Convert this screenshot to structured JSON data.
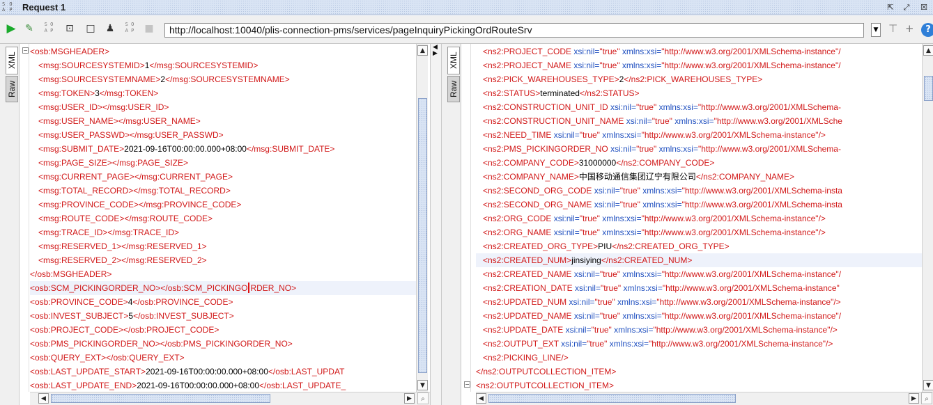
{
  "window": {
    "title": "Request 1",
    "logo_text": "SO\nAP"
  },
  "toolbar": {
    "url": "http://localhost:10040/plis-connection-pms/services/pageInquiryPickingOrdRouteSrv"
  },
  "tabs": {
    "xml": "XML",
    "raw": "Raw"
  },
  "request_lines": [
    {
      "indent": 0,
      "segs": [
        [
          "t",
          "<osb:MSGHEADER>"
        ]
      ]
    },
    {
      "indent": 1,
      "segs": [
        [
          "t",
          "<msg:SOURCESYSTEMID>"
        ],
        [
          "x",
          "1"
        ],
        [
          "t",
          "</msg:SOURCESYSTEMID>"
        ]
      ]
    },
    {
      "indent": 1,
      "segs": [
        [
          "t",
          "<msg:SOURCESYSTEMNAME>"
        ],
        [
          "x",
          "2"
        ],
        [
          "t",
          "</msg:SOURCESYSTEMNAME>"
        ]
      ]
    },
    {
      "indent": 1,
      "segs": [
        [
          "t",
          "<msg:TOKEN>"
        ],
        [
          "x",
          "3"
        ],
        [
          "t",
          "</msg:TOKEN>"
        ]
      ]
    },
    {
      "indent": 1,
      "segs": [
        [
          "t",
          "<msg:USER_ID></msg:USER_ID>"
        ]
      ]
    },
    {
      "indent": 1,
      "segs": [
        [
          "t",
          "<msg:USER_NAME></msg:USER_NAME>"
        ]
      ]
    },
    {
      "indent": 1,
      "segs": [
        [
          "t",
          "<msg:USER_PASSWD></msg:USER_PASSWD>"
        ]
      ]
    },
    {
      "indent": 1,
      "segs": [
        [
          "t",
          "<msg:SUBMIT_DATE>"
        ],
        [
          "x",
          "2021-09-16T00:00:00.000+08:00"
        ],
        [
          "t",
          "</msg:SUBMIT_DATE>"
        ]
      ]
    },
    {
      "indent": 1,
      "segs": [
        [
          "t",
          "<msg:PAGE_SIZE></msg:PAGE_SIZE>"
        ]
      ]
    },
    {
      "indent": 1,
      "segs": [
        [
          "t",
          "<msg:CURRENT_PAGE></msg:CURRENT_PAGE>"
        ]
      ]
    },
    {
      "indent": 1,
      "segs": [
        [
          "t",
          "<msg:TOTAL_RECORD></msg:TOTAL_RECORD>"
        ]
      ]
    },
    {
      "indent": 1,
      "segs": [
        [
          "t",
          "<msg:PROVINCE_CODE></msg:PROVINCE_CODE>"
        ]
      ]
    },
    {
      "indent": 1,
      "segs": [
        [
          "t",
          "<msg:ROUTE_CODE></msg:ROUTE_CODE>"
        ]
      ]
    },
    {
      "indent": 1,
      "segs": [
        [
          "t",
          "<msg:TRACE_ID></msg:TRACE_ID>"
        ]
      ]
    },
    {
      "indent": 1,
      "segs": [
        [
          "t",
          "<msg:RESERVED_1></msg:RESERVED_1>"
        ]
      ]
    },
    {
      "indent": 1,
      "segs": [
        [
          "t",
          "<msg:RESERVED_2></msg:RESERVED_2>"
        ]
      ]
    },
    {
      "indent": 0,
      "segs": [
        [
          "t",
          "</osb:MSGHEADER>"
        ]
      ]
    },
    {
      "indent": 0,
      "hl": true,
      "caret_after": "<osb:SCM_PICKINGORDER_NO></osb:SCM_PICKINGO",
      "segs": [
        [
          "t",
          "<osb:SCM_PICKINGORDER_NO></osb:SCM_PICKINGORDER_NO>"
        ]
      ]
    },
    {
      "indent": 0,
      "segs": [
        [
          "t",
          "<osb:PROVINCE_CODE>"
        ],
        [
          "x",
          "4"
        ],
        [
          "t",
          "</osb:PROVINCE_CODE>"
        ]
      ]
    },
    {
      "indent": 0,
      "segs": [
        [
          "t",
          "<osb:INVEST_SUBJECT>"
        ],
        [
          "x",
          "5"
        ],
        [
          "t",
          "</osb:INVEST_SUBJECT>"
        ]
      ]
    },
    {
      "indent": 0,
      "segs": [
        [
          "t",
          "<osb:PROJECT_CODE></osb:PROJECT_CODE>"
        ]
      ]
    },
    {
      "indent": 0,
      "segs": [
        [
          "t",
          "<osb:PMS_PICKINGORDER_NO></osb:PMS_PICKINGORDER_NO>"
        ]
      ]
    },
    {
      "indent": 0,
      "segs": [
        [
          "t",
          "<osb:QUERY_EXT></osb:QUERY_EXT>"
        ]
      ]
    },
    {
      "indent": 0,
      "segs": [
        [
          "t",
          "<osb:LAST_UPDATE_START>"
        ],
        [
          "x",
          "2021-09-16T00:00:00.000+08:00"
        ],
        [
          "t",
          "</osb:LAST_UPDAT"
        ]
      ]
    },
    {
      "indent": 0,
      "segs": [
        [
          "t",
          "<osb:LAST_UPDATE_END>"
        ],
        [
          "x",
          "2021-09-16T00:00:00.000+08:00"
        ],
        [
          "t",
          "</osb:LAST_UPDATE_"
        ]
      ]
    }
  ],
  "response_lines": [
    {
      "indent": 1,
      "segs": [
        [
          "t",
          "<ns2:PROJECT_CODE "
        ],
        [
          "a",
          "xsi:nil="
        ],
        [
          "v",
          "\"true\" "
        ],
        [
          "a",
          "xmlns:xsi="
        ],
        [
          "v",
          "\"http://www.w3.org/2001/XMLSchema-instance\"/"
        ]
      ]
    },
    {
      "indent": 1,
      "segs": [
        [
          "t",
          "<ns2:PROJECT_NAME "
        ],
        [
          "a",
          "xsi:nil="
        ],
        [
          "v",
          "\"true\" "
        ],
        [
          "a",
          "xmlns:xsi="
        ],
        [
          "v",
          "\"http://www.w3.org/2001/XMLSchema-instance\"/"
        ]
      ]
    },
    {
      "indent": 1,
      "segs": [
        [
          "t",
          "<ns2:PICK_WAREHOUSES_TYPE>"
        ],
        [
          "x",
          "2"
        ],
        [
          "t",
          "</ns2:PICK_WAREHOUSES_TYPE>"
        ]
      ]
    },
    {
      "indent": 1,
      "segs": [
        [
          "t",
          "<ns2:STATUS>"
        ],
        [
          "x",
          "terminated"
        ],
        [
          "t",
          "</ns2:STATUS>"
        ]
      ]
    },
    {
      "indent": 1,
      "segs": [
        [
          "t",
          "<ns2:CONSTRUCTION_UNIT_ID "
        ],
        [
          "a",
          "xsi:nil="
        ],
        [
          "v",
          "\"true\" "
        ],
        [
          "a",
          "xmlns:xsi="
        ],
        [
          "v",
          "\"http://www.w3.org/2001/XMLSchema-"
        ]
      ]
    },
    {
      "indent": 1,
      "segs": [
        [
          "t",
          "<ns2:CONSTRUCTION_UNIT_NAME "
        ],
        [
          "a",
          "xsi:nil="
        ],
        [
          "v",
          "\"true\" "
        ],
        [
          "a",
          "xmlns:xsi="
        ],
        [
          "v",
          "\"http://www.w3.org/2001/XMLSche"
        ]
      ]
    },
    {
      "indent": 1,
      "segs": [
        [
          "t",
          "<ns2:NEED_TIME "
        ],
        [
          "a",
          "xsi:nil="
        ],
        [
          "v",
          "\"true\" "
        ],
        [
          "a",
          "xmlns:xsi="
        ],
        [
          "v",
          "\"http://www.w3.org/2001/XMLSchema-instance\"/>"
        ]
      ]
    },
    {
      "indent": 1,
      "segs": [
        [
          "t",
          "<ns2:PMS_PICKINGORDER_NO "
        ],
        [
          "a",
          "xsi:nil="
        ],
        [
          "v",
          "\"true\" "
        ],
        [
          "a",
          "xmlns:xsi="
        ],
        [
          "v",
          "\"http://www.w3.org/2001/XMLSchema-"
        ]
      ]
    },
    {
      "indent": 1,
      "segs": [
        [
          "t",
          "<ns2:COMPANY_CODE>"
        ],
        [
          "x",
          "31000000"
        ],
        [
          "t",
          "</ns2:COMPANY_CODE>"
        ]
      ]
    },
    {
      "indent": 1,
      "segs": [
        [
          "t",
          "<ns2:COMPANY_NAME>"
        ],
        [
          "x",
          "中国移动通信集团辽宁有限公司"
        ],
        [
          "t",
          "</ns2:COMPANY_NAME>"
        ]
      ]
    },
    {
      "indent": 1,
      "segs": [
        [
          "t",
          "<ns2:SECOND_ORG_CODE "
        ],
        [
          "a",
          "xsi:nil="
        ],
        [
          "v",
          "\"true\" "
        ],
        [
          "a",
          "xmlns:xsi="
        ],
        [
          "v",
          "\"http://www.w3.org/2001/XMLSchema-insta"
        ]
      ]
    },
    {
      "indent": 1,
      "segs": [
        [
          "t",
          "<ns2:SECOND_ORG_NAME "
        ],
        [
          "a",
          "xsi:nil="
        ],
        [
          "v",
          "\"true\" "
        ],
        [
          "a",
          "xmlns:xsi="
        ],
        [
          "v",
          "\"http://www.w3.org/2001/XMLSchema-insta"
        ]
      ]
    },
    {
      "indent": 1,
      "segs": [
        [
          "t",
          "<ns2:ORG_CODE "
        ],
        [
          "a",
          "xsi:nil="
        ],
        [
          "v",
          "\"true\" "
        ],
        [
          "a",
          "xmlns:xsi="
        ],
        [
          "v",
          "\"http://www.w3.org/2001/XMLSchema-instance\"/>"
        ]
      ]
    },
    {
      "indent": 1,
      "segs": [
        [
          "t",
          "<ns2:ORG_NAME "
        ],
        [
          "a",
          "xsi:nil="
        ],
        [
          "v",
          "\"true\" "
        ],
        [
          "a",
          "xmlns:xsi="
        ],
        [
          "v",
          "\"http://www.w3.org/2001/XMLSchema-instance\"/>"
        ]
      ]
    },
    {
      "indent": 1,
      "segs": [
        [
          "t",
          "<ns2:CREATED_ORG_TYPE>"
        ],
        [
          "x",
          "PIU"
        ],
        [
          "t",
          "</ns2:CREATED_ORG_TYPE>"
        ]
      ]
    },
    {
      "indent": 1,
      "hl": true,
      "segs": [
        [
          "t",
          "<ns2:CREATED_NUM>"
        ],
        [
          "x",
          "jinsiying"
        ],
        [
          "t",
          "</ns2:CREATED_NUM>"
        ]
      ]
    },
    {
      "indent": 1,
      "segs": [
        [
          "t",
          "<ns2:CREATED_NAME "
        ],
        [
          "a",
          "xsi:nil="
        ],
        [
          "v",
          "\"true\" "
        ],
        [
          "a",
          "xmlns:xsi="
        ],
        [
          "v",
          "\"http://www.w3.org/2001/XMLSchema-instance\"/"
        ]
      ]
    },
    {
      "indent": 1,
      "segs": [
        [
          "t",
          "<ns2:CREATION_DATE "
        ],
        [
          "a",
          "xsi:nil="
        ],
        [
          "v",
          "\"true\" "
        ],
        [
          "a",
          "xmlns:xsi="
        ],
        [
          "v",
          "\"http://www.w3.org/2001/XMLSchema-instance\""
        ]
      ]
    },
    {
      "indent": 1,
      "segs": [
        [
          "t",
          "<ns2:UPDATED_NUM "
        ],
        [
          "a",
          "xsi:nil="
        ],
        [
          "v",
          "\"true\" "
        ],
        [
          "a",
          "xmlns:xsi="
        ],
        [
          "v",
          "\"http://www.w3.org/2001/XMLSchema-instance\"/>"
        ]
      ]
    },
    {
      "indent": 1,
      "segs": [
        [
          "t",
          "<ns2:UPDATED_NAME "
        ],
        [
          "a",
          "xsi:nil="
        ],
        [
          "v",
          "\"true\" "
        ],
        [
          "a",
          "xmlns:xsi="
        ],
        [
          "v",
          "\"http://www.w3.org/2001/XMLSchema-instance\"/"
        ]
      ]
    },
    {
      "indent": 1,
      "segs": [
        [
          "t",
          "<ns2:UPDATE_DATE "
        ],
        [
          "a",
          "xsi:nil="
        ],
        [
          "v",
          "\"true\" "
        ],
        [
          "a",
          "xmlns:xsi="
        ],
        [
          "v",
          "\"http://www.w3.org/2001/XMLSchema-instance\"/>"
        ]
      ]
    },
    {
      "indent": 1,
      "segs": [
        [
          "t",
          "<ns2:OUTPUT_EXT "
        ],
        [
          "a",
          "xsi:nil="
        ],
        [
          "v",
          "\"true\" "
        ],
        [
          "a",
          "xmlns:xsi="
        ],
        [
          "v",
          "\"http://www.w3.org/2001/XMLSchema-instance\"/>"
        ]
      ]
    },
    {
      "indent": 1,
      "segs": [
        [
          "t",
          "<ns2:PICKING_LINE/>"
        ]
      ]
    },
    {
      "indent": 0,
      "segs": [
        [
          "t",
          "</ns2:OUTPUTCOLLECTION_ITEM>"
        ]
      ]
    },
    {
      "indent": 0,
      "segs": [
        [
          "t",
          "<ns2:OUTPUTCOLLECTION_ITEM>"
        ]
      ]
    }
  ],
  "colors": {
    "tag": "#d11818",
    "attr": "#2050c0",
    "text": "#000000",
    "accent": "#2f7fd8",
    "run": "#1bab2c"
  }
}
